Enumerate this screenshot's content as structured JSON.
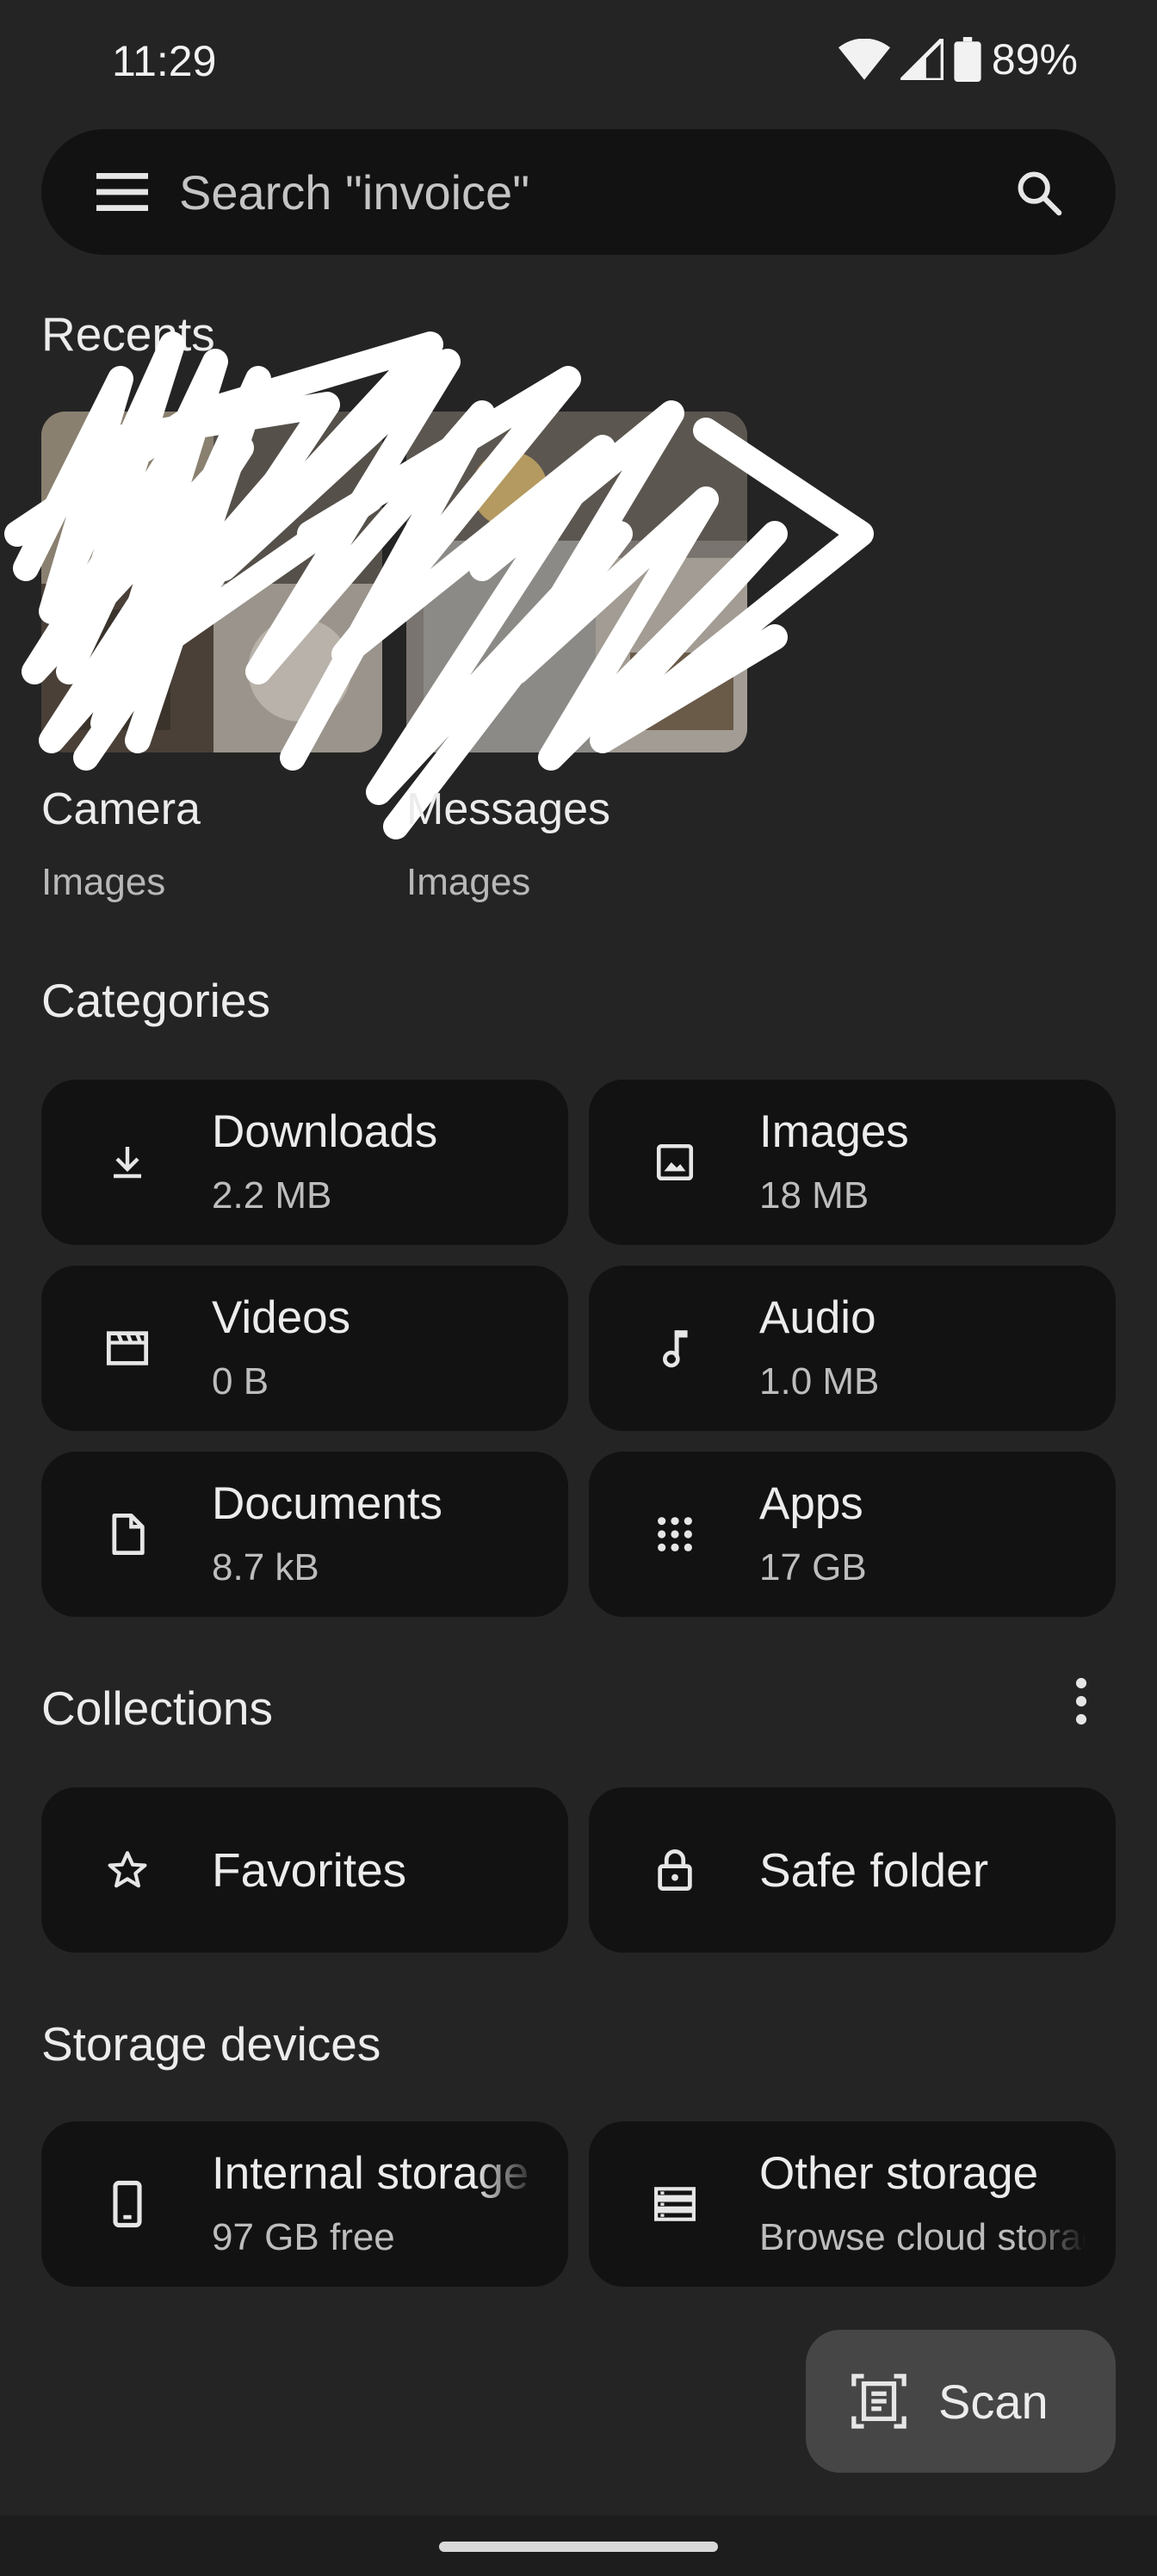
{
  "status_bar": {
    "time": "11:29",
    "battery": "89%",
    "icons": [
      "wifi-icon",
      "signal-icon",
      "battery-icon"
    ]
  },
  "search": {
    "placeholder": "Search \"invoice\""
  },
  "recents": {
    "title": "Recents",
    "items": [
      {
        "title": "Camera",
        "subtitle": "Images"
      },
      {
        "title": "Messages",
        "subtitle": "Images"
      }
    ]
  },
  "categories": {
    "title": "Categories",
    "items": [
      {
        "label": "Downloads",
        "size": "2.2 MB",
        "icon": "download-icon"
      },
      {
        "label": "Images",
        "size": "18 MB",
        "icon": "image-icon"
      },
      {
        "label": "Videos",
        "size": "0 B",
        "icon": "video-icon"
      },
      {
        "label": "Audio",
        "size": "1.0 MB",
        "icon": "music-note-icon"
      },
      {
        "label": "Documents",
        "size": "8.7 kB",
        "icon": "document-icon"
      },
      {
        "label": "Apps",
        "size": "17 GB",
        "icon": "apps-grid-icon"
      }
    ]
  },
  "collections": {
    "title": "Collections",
    "items": [
      {
        "label": "Favorites",
        "icon": "star-icon"
      },
      {
        "label": "Safe folder",
        "icon": "lock-icon"
      }
    ]
  },
  "storage": {
    "title": "Storage devices",
    "items": [
      {
        "label": "Internal storage",
        "sub": "97 GB free",
        "icon": "phone-icon"
      },
      {
        "label": "Other storage",
        "sub": "Browse cloud storage",
        "icon": "storage-icon"
      }
    ]
  },
  "fab": {
    "label": "Scan",
    "icon": "document-scanner-icon"
  },
  "colors": {
    "background": "#242424",
    "tile": "#121212",
    "fab": "#464646",
    "text": "#ececec"
  }
}
